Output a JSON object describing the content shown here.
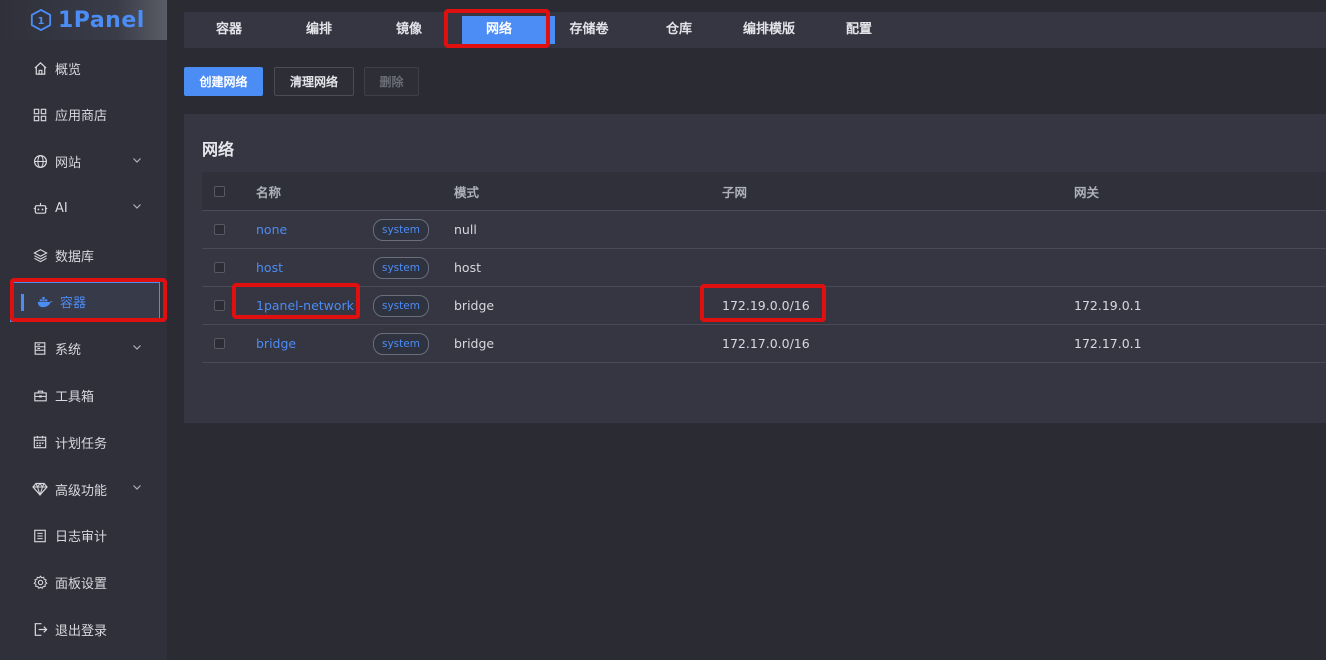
{
  "app": {
    "name": "1Panel"
  },
  "sidebar": {
    "items": [
      {
        "label": "概览",
        "icon": "home-icon"
      },
      {
        "label": "应用商店",
        "icon": "grid-icon"
      },
      {
        "label": "网站",
        "icon": "globe-icon",
        "expandable": true
      },
      {
        "label": "AI",
        "icon": "robot-icon",
        "expandable": true
      },
      {
        "label": "数据库",
        "icon": "layers-icon"
      },
      {
        "label": "容器",
        "icon": "docker-icon",
        "active": true
      },
      {
        "label": "系统",
        "icon": "server-icon",
        "expandable": true
      },
      {
        "label": "工具箱",
        "icon": "toolbox-icon"
      },
      {
        "label": "计划任务",
        "icon": "calendar-icon"
      },
      {
        "label": "高级功能",
        "icon": "diamond-icon",
        "expandable": true
      },
      {
        "label": "日志审计",
        "icon": "log-icon"
      },
      {
        "label": "面板设置",
        "icon": "gear-icon"
      },
      {
        "label": "退出登录",
        "icon": "logout-icon"
      }
    ]
  },
  "tabs": [
    "容器",
    "编排",
    "镜像",
    "网络",
    "存储卷",
    "仓库",
    "编排模版",
    "配置"
  ],
  "active_tab": "网络",
  "toolbar": {
    "create_label": "创建网络",
    "prune_label": "清理网络",
    "delete_label": "删除"
  },
  "card": {
    "title": "网络",
    "columns": [
      "名称",
      "模式",
      "子网",
      "网关"
    ],
    "rows": [
      {
        "name": "none",
        "tag": "system",
        "mode": "null",
        "subnet": "",
        "gateway": ""
      },
      {
        "name": "host",
        "tag": "system",
        "mode": "host",
        "subnet": "",
        "gateway": ""
      },
      {
        "name": "1panel-network",
        "tag": "system",
        "mode": "bridge",
        "subnet": "172.19.0.0/16",
        "gateway": "172.19.0.1"
      },
      {
        "name": "bridge",
        "tag": "system",
        "mode": "bridge",
        "subnet": "172.17.0.0/16",
        "gateway": "172.17.0.1"
      }
    ]
  },
  "colors": {
    "accent": "#4b8cf5",
    "highlight": "#e01010"
  }
}
